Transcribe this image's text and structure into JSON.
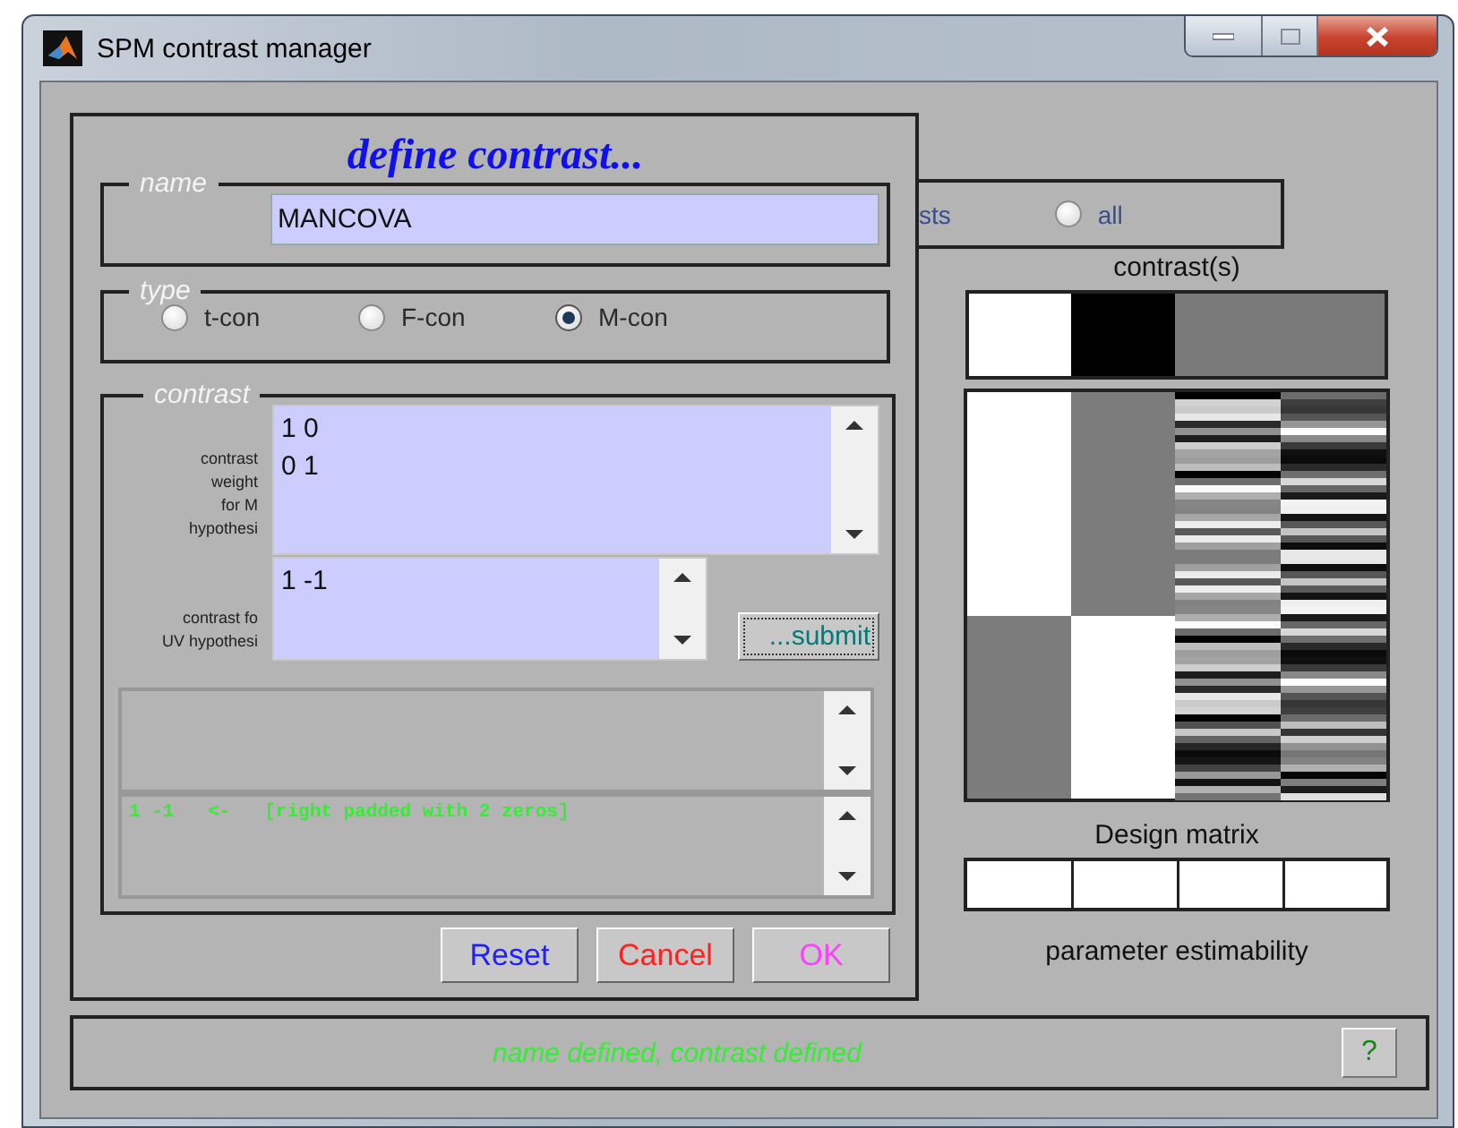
{
  "window": {
    "title": "SPM contrast manager"
  },
  "background": {
    "partial_label": "sts",
    "radio_option": {
      "label": "all",
      "selected": false
    },
    "contrast_label": "contrast(s)",
    "design_matrix_label": "Design matrix",
    "estimability_label": "parameter estimability"
  },
  "define_panel": {
    "heading": "define contrast...",
    "name": {
      "legend": "name",
      "value": "MANCOVA"
    },
    "type": {
      "legend": "type",
      "options": [
        {
          "label": "t-con",
          "selected": false
        },
        {
          "label": "F-con",
          "selected": false
        },
        {
          "label": "M-con",
          "selected": true
        }
      ]
    },
    "contrast": {
      "legend": "contrast",
      "weights_label": [
        "contrast",
        "weight",
        "for M",
        "hypothesi"
      ],
      "weights_value": "1 0\n0 1",
      "uv_label": [
        "contrast fo",
        "UV hypothesi"
      ],
      "uv_value": "1 -1",
      "submit": "...submit",
      "output": "1 -1   <-   [right padded with 2 zeros]"
    },
    "buttons": [
      {
        "label": "Reset",
        "color": "#2020ff"
      },
      {
        "label": "Cancel",
        "color": "#ff2020"
      },
      {
        "label": "OK",
        "color": "#ff40ff"
      }
    ]
  },
  "status_bar": {
    "text": "name defined, contrast defined",
    "help": "?"
  }
}
